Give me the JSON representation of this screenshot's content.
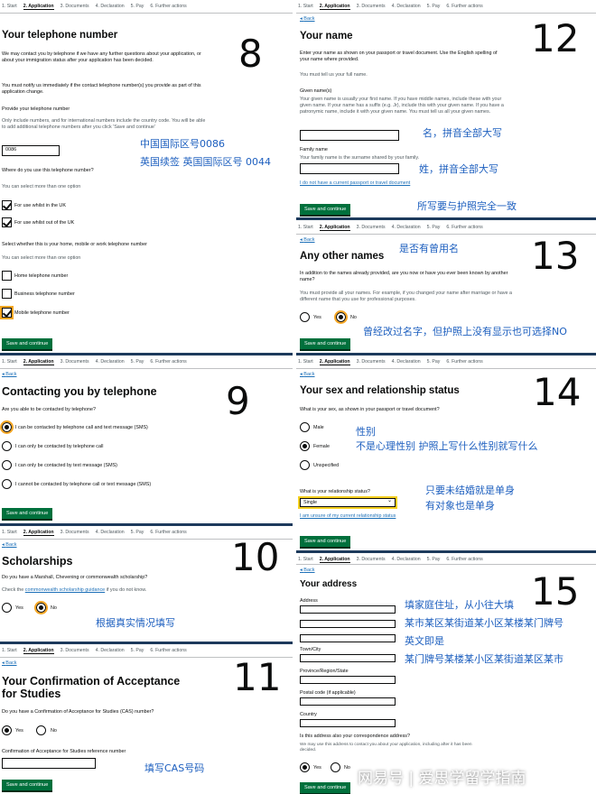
{
  "steps": [
    "1. Start",
    "2. Application",
    "3. Documents",
    "4. Declaration",
    "5. Pay",
    "6. Further actions"
  ],
  "back": "Back",
  "continue": "Save and continue",
  "p8": {
    "num": "8",
    "title": "Your telephone number",
    "intro": "We may contact you by telephone if we have any further questions about your application, or about your immigration status after your application has been decided.",
    "notify": "You must notify us immediately if the contact telephone number(s) you provide as part of this application change.",
    "provide_label": "Provide your telephone number",
    "provide_hint": "Only include numbers, and for international numbers include the country code. You will be able to add additional telephone numbers after you click 'Save and continue'",
    "phone_value": "0086",
    "note": [
      "中国国际区号0086",
      "英国续签 英国国际区号 0044"
    ],
    "where_q": "Where do you use this telephone number?",
    "select_hint": "You can select more than one option",
    "where_opts": [
      "For use whilst in the UK",
      "For use whilst out of the UK"
    ],
    "type_q": "Select whether this is your home, mobile or work telephone number",
    "type_opts": [
      "Home telephone number",
      "Business telephone number",
      "Mobile telephone number"
    ]
  },
  "p9": {
    "num": "9",
    "title": "Contacting you by telephone",
    "question": "Are you able to be contacted by telephone?",
    "options": [
      "I can be contacted by telephone call and text message (SMS)",
      "I can only be contacted by telephone call",
      "I can only be contacted by text message (SMS)",
      "I cannot be contacted by telephone call or text message (SMS)"
    ]
  },
  "p10": {
    "num": "10",
    "title": "Scholarships",
    "question": "Do you have a Marshall, Chevening or commonwealth scholarship?",
    "hint_pre": "Check the",
    "hint_link": "commonwealth scholarship guidance",
    "hint_post": "if you do not know.",
    "yes": "Yes",
    "no": "No",
    "note": "根据真实情况填写"
  },
  "p11": {
    "num": "11",
    "title": "Your Confirmation of Acceptance for Studies",
    "question": "Do you have a Confirmation of Acceptance for Studies (CAS) number?",
    "yes": "Yes",
    "no": "No",
    "ref_label": "Confirmation of Acceptance for Studies reference number",
    "note": "填写CAS号码"
  },
  "p12": {
    "num": "12",
    "title": "Your name",
    "intro": "Enter your name as shown on your passport or travel document. Use the English spelling of your name where provided.",
    "must": "You must tell us your full name.",
    "given_label": "Given name(s)",
    "given_hint": "Your given name is usually your first name. If you have middle names, include these with your given name. If your name has a suffix (e.g. Jr), include this with your given name. If you have a patronymic name, include it with your given name. You must tell us all your given names.",
    "family_label": "Family name",
    "family_hint": "Your family name is the surname shared by your family.",
    "link": "I do not have a current passport or travel document",
    "note_given": "名，拼音全部大写",
    "note_family": "姓，拼音全部大写",
    "note_match": "所写要与护照完全一致"
  },
  "p13": {
    "num": "13",
    "title": "Any other names",
    "question": "In addition to the names already provided, are you now or have you ever been known by another name?",
    "hint": "You must provide all your names. For example, if you changed your name after marriage or have a different name that you use for professional purposes.",
    "yes": "Yes",
    "no": "No",
    "note_q": "是否有曾用名",
    "note_a": "曾经改过名字，但护照上没有显示也可选择NO"
  },
  "p14": {
    "num": "14",
    "title": "Your sex and relationship status",
    "sex_q": "What is your sex, as shown in your passport or travel document?",
    "sex_opts": [
      "Male",
      "Female",
      "Unspecified"
    ],
    "note_sex": [
      "性别",
      "不是心理性别 护照上写什么性别就写什么"
    ],
    "rel_q": "What is your relationship status?",
    "rel_value": "Single",
    "rel_link": "I am unsure of my current relationship status",
    "note_rel": [
      "只要未结婚就是单身",
      "有对象也是单身"
    ]
  },
  "p15": {
    "num": "15",
    "title": "Your address",
    "fields": [
      "Address",
      "",
      "",
      "Town/City",
      "Province/Region/State",
      "Postal code (if applicable)",
      "Country"
    ],
    "corr_q": "Is this address also your correspondence address?",
    "corr_hint": "We may use this address to contact you about your application, including after it has been decided.",
    "yes": "Yes",
    "no": "No",
    "note": [
      "填家庭住址，从小往大填",
      "某市某区某街道某小区某楼某门牌号",
      "英文即是",
      "某门牌号某楼某小区某街道某区某市"
    ]
  },
  "watermark": "网易号 | 爱思学留学指南",
  "colors": {
    "button": "#00703c",
    "link": "#1d70b8",
    "note": "#1d5fbf",
    "separator": "#1d3a5c"
  }
}
